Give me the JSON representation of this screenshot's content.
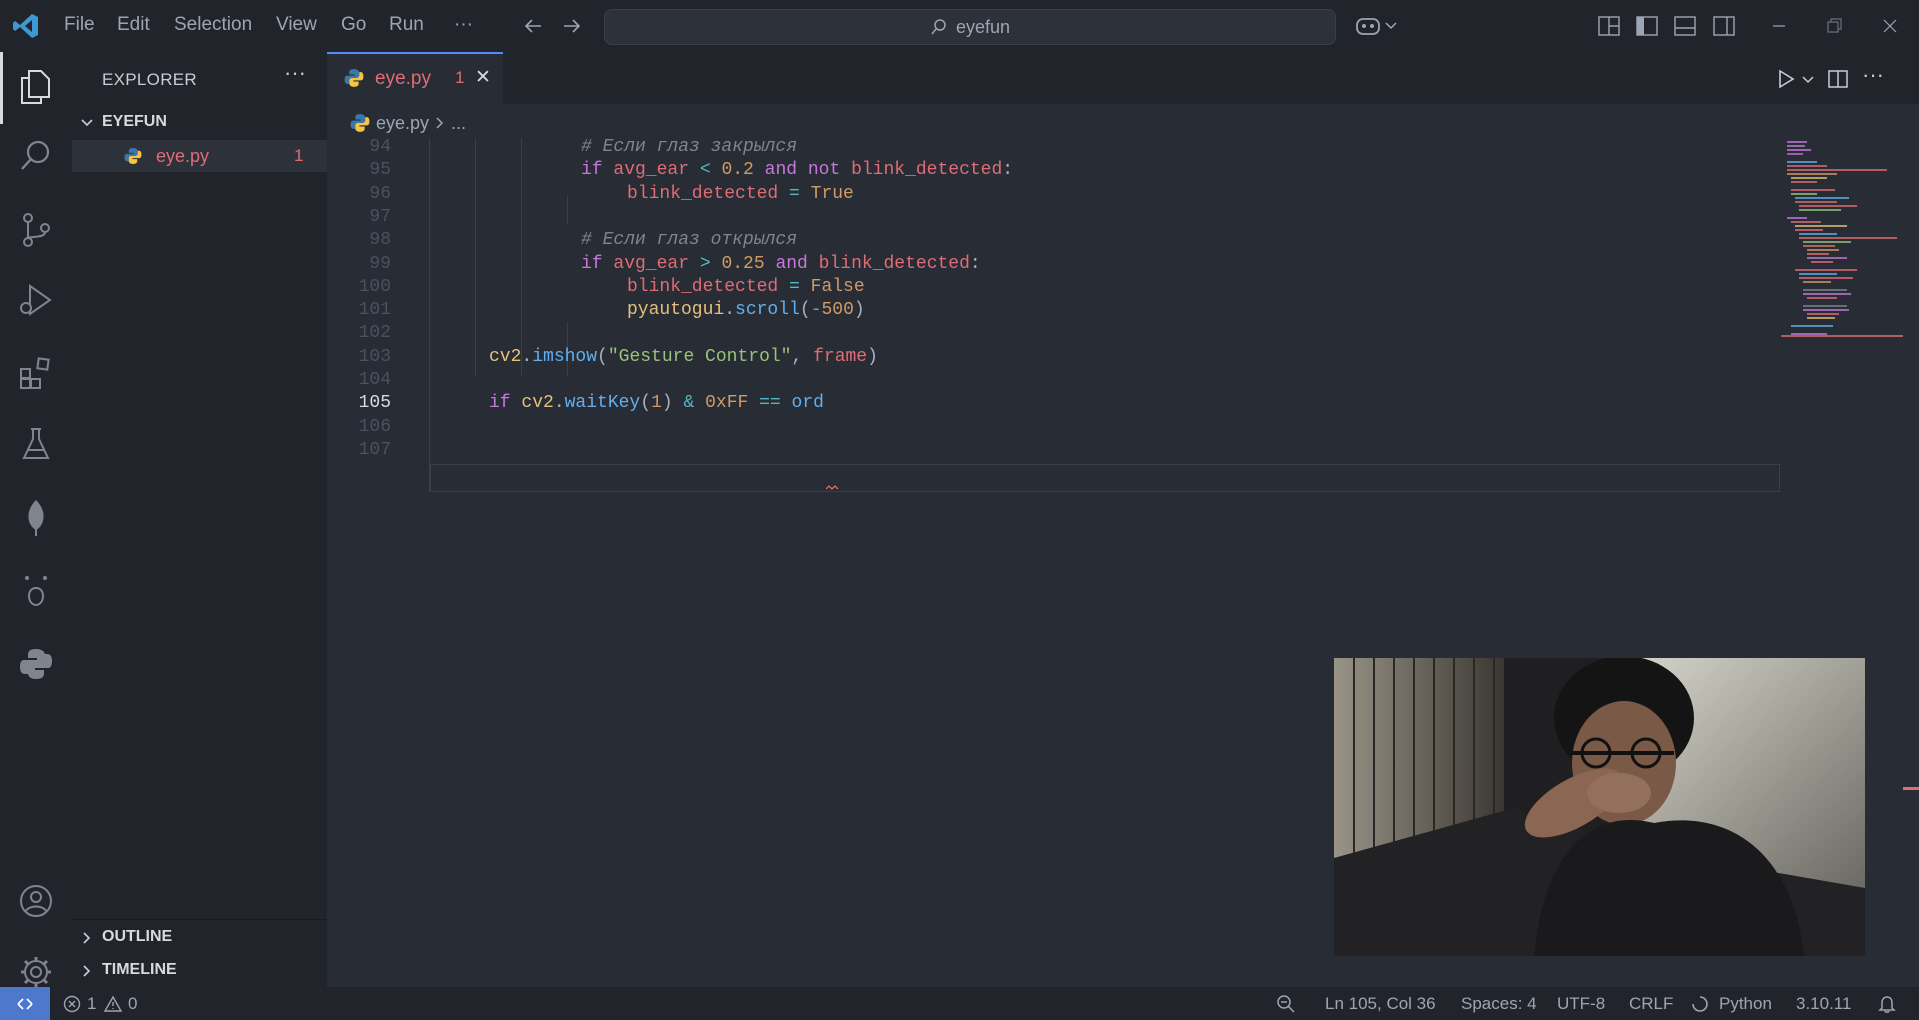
{
  "menu": [
    "File",
    "Edit",
    "Selection",
    "View",
    "Go",
    "Run",
    "···"
  ],
  "search": {
    "text": "eyefun"
  },
  "sidebar": {
    "title": "EXPLORER",
    "folder": "EYEFUN",
    "file": {
      "name": "eye.py",
      "problems": "1"
    },
    "sections": [
      "OUTLINE",
      "TIMELINE"
    ]
  },
  "tab": {
    "name": "eye.py",
    "problems": "1",
    "close": "✕"
  },
  "breadcrumb": {
    "file": "eye.py",
    "more": "..."
  },
  "code_lines": [
    {
      "n": "94",
      "tokens": [
        {
          "c": "cmt",
          "t": "# Если глаз закрылся"
        }
      ]
    },
    {
      "n": "95",
      "tokens": [
        {
          "c": "kw",
          "t": "if "
        },
        {
          "c": "var",
          "t": "avg_ear"
        },
        {
          "c": "op",
          "t": " < "
        },
        {
          "c": "num",
          "t": "0.2"
        },
        {
          "c": "kw",
          "t": " and not "
        },
        {
          "c": "var",
          "t": "blink_detected"
        },
        {
          "c": "pl",
          "t": ":"
        }
      ]
    },
    {
      "n": "96",
      "tokens": [
        {
          "c": "var",
          "t": "blink_detected"
        },
        {
          "c": "op",
          "t": " = "
        },
        {
          "c": "num",
          "t": "True"
        }
      ]
    },
    {
      "n": "97",
      "tokens": []
    },
    {
      "n": "98",
      "tokens": [
        {
          "c": "cmt",
          "t": "# Если глаз открылся"
        }
      ]
    },
    {
      "n": "99",
      "tokens": [
        {
          "c": "kw",
          "t": "if "
        },
        {
          "c": "var",
          "t": "avg_ear"
        },
        {
          "c": "op",
          "t": " > "
        },
        {
          "c": "num",
          "t": "0.25"
        },
        {
          "c": "kw",
          "t": " and "
        },
        {
          "c": "var",
          "t": "blink_detected"
        },
        {
          "c": "pl",
          "t": ":"
        }
      ]
    },
    {
      "n": "100",
      "tokens": [
        {
          "c": "var",
          "t": "blink_detected"
        },
        {
          "c": "op",
          "t": " = "
        },
        {
          "c": "num",
          "t": "False"
        }
      ]
    },
    {
      "n": "101",
      "tokens": [
        {
          "c": "cls",
          "t": "pyautogui"
        },
        {
          "c": "pl",
          "t": "."
        },
        {
          "c": "fn",
          "t": "scroll"
        },
        {
          "c": "pl",
          "t": "("
        },
        {
          "c": "op",
          "t": "-"
        },
        {
          "c": "num",
          "t": "500"
        },
        {
          "c": "pl",
          "t": ")"
        }
      ]
    },
    {
      "n": "102",
      "tokens": []
    },
    {
      "n": "103",
      "tokens": [
        {
          "c": "cls",
          "t": "cv2"
        },
        {
          "c": "pl",
          "t": "."
        },
        {
          "c": "fn",
          "t": "imshow"
        },
        {
          "c": "pl",
          "t": "("
        },
        {
          "c": "str",
          "t": "\"Gesture Control\""
        },
        {
          "c": "pl",
          "t": ", "
        },
        {
          "c": "var",
          "t": "frame"
        },
        {
          "c": "pl",
          "t": ")"
        }
      ]
    },
    {
      "n": "104",
      "tokens": []
    },
    {
      "n": "105",
      "tokens": [
        {
          "c": "kw",
          "t": "if "
        },
        {
          "c": "cls",
          "t": "cv2"
        },
        {
          "c": "pl",
          "t": "."
        },
        {
          "c": "fn",
          "t": "waitKey"
        },
        {
          "c": "pl",
          "t": "("
        },
        {
          "c": "num",
          "t": "1"
        },
        {
          "c": "pl",
          "t": ")"
        },
        {
          "c": "op",
          "t": " & "
        },
        {
          "c": "num",
          "t": "0xFF"
        },
        {
          "c": "op",
          "t": " == "
        },
        {
          "c": "fn",
          "t": "ord"
        }
      ]
    },
    {
      "n": "106",
      "tokens": []
    },
    {
      "n": "107",
      "tokens": []
    }
  ],
  "status": {
    "errors": "1",
    "warnings": "0",
    "position": "Ln 105, Col 36",
    "spaces": "Spaces: 4",
    "encoding": "UTF-8",
    "eol": "CRLF",
    "language": "Python",
    "version": "3.10.11"
  },
  "colors": {
    "accent": "#528bff",
    "error": "#e06c75"
  }
}
